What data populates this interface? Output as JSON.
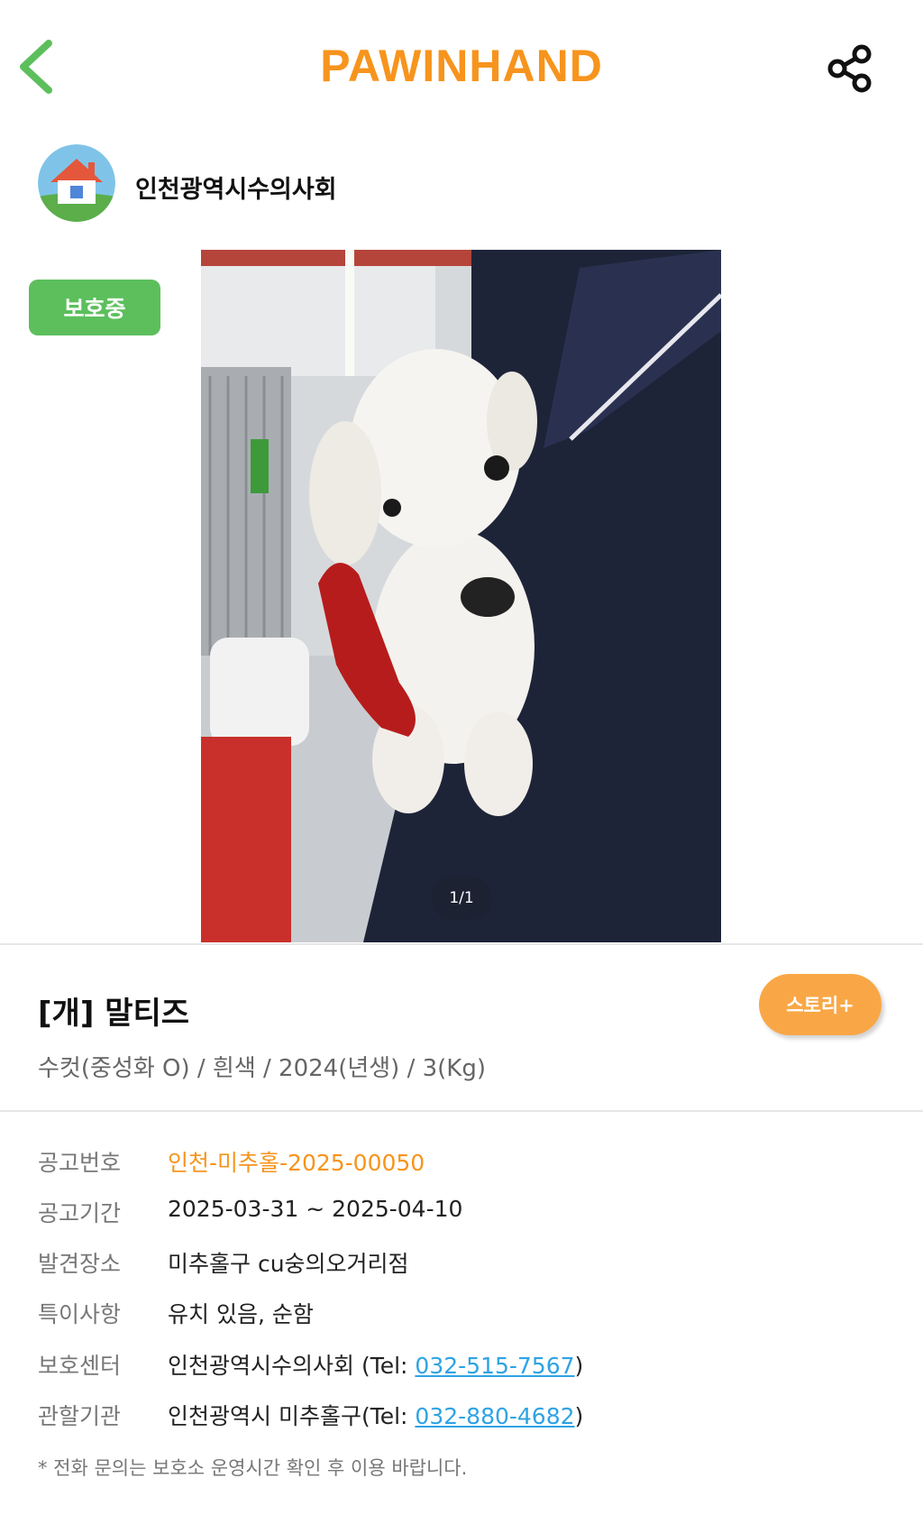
{
  "header": {
    "brand": "PAWINHAND",
    "brand_color": "#F7941D",
    "back_icon": "chevron-left-icon",
    "share_icon": "share-icon"
  },
  "shelter": {
    "name": "인천광역시수의사회",
    "avatar_icon": "house-icon"
  },
  "status": {
    "label": "보호중",
    "color": "#5CBF5C"
  },
  "photo": {
    "counter": "1/1"
  },
  "animal": {
    "title": "[개] 말티즈",
    "summary": "수컷(중성화 O) / 흰색 / 2024(년생) / 3(Kg)",
    "story_label": "스토리+",
    "story_color": "#F9A746"
  },
  "info": {
    "notice_no": {
      "label": "공고번호",
      "value": "인천-미추홀-2025-00050",
      "color": "#F7941D"
    },
    "notice_period": {
      "label": "공고기간",
      "value": "2025-03-31 ~ 2025-04-10"
    },
    "found_place": {
      "label": "발견장소",
      "value": "미추홀구 cu숭의오거리점"
    },
    "features": {
      "label": "특이사항",
      "value": "유치 있음, 순함"
    },
    "center": {
      "label": "보호센터",
      "name": "인천광역시수의사회 (Tel: ",
      "phone": "032-515-7567",
      "close": ")"
    },
    "authority": {
      "label": "관할기관",
      "name": "인천광역시 미추홀구(Tel: ",
      "phone": "032-880-4682",
      "close": ")"
    },
    "link_color": "#2EA3E3"
  },
  "notice": "* 전화 문의는 보호소 운영시간 확인 후 이용 바랍니다."
}
